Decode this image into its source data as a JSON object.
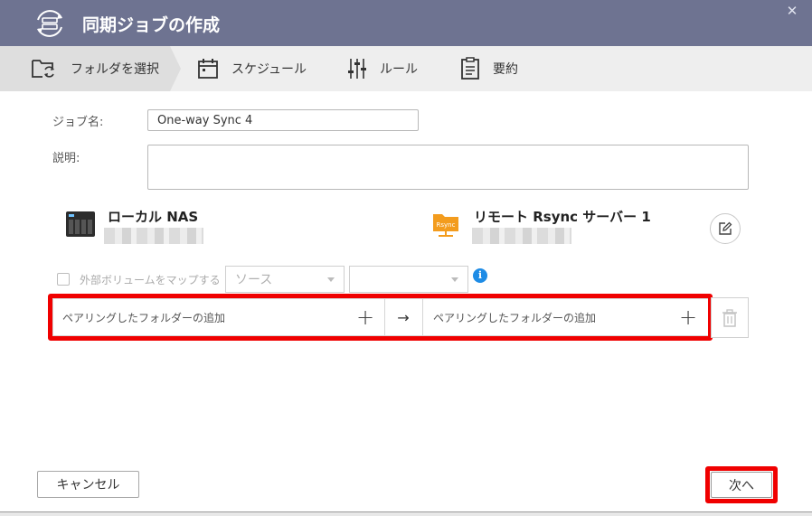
{
  "titlebar": {
    "title": "同期ジョブの作成",
    "close_symbol": "✕"
  },
  "steps": [
    {
      "label": "フォルダを選択",
      "icon": "folder-sync-icon",
      "active": true
    },
    {
      "label": "スケジュール",
      "icon": "calendar-icon",
      "active": false
    },
    {
      "label": "ルール",
      "icon": "sliders-icon",
      "active": false
    },
    {
      "label": "要約",
      "icon": "clipboard-icon",
      "active": false
    }
  ],
  "form": {
    "job_name_label": "ジョブ名:",
    "job_name_value": "One-way Sync 4",
    "description_label": "説明:",
    "description_value": ""
  },
  "local": {
    "name": "ローカル NAS",
    "icon": "nas-device-icon"
  },
  "remote": {
    "name": "リモート Rsync サーバー 1",
    "icon": "rsync-folder-icon",
    "badge": "Rsync"
  },
  "mapping": {
    "checkbox_label": "外部ボリュームをマップする",
    "source_select": "ソース",
    "second_select": "",
    "info_symbol": "i"
  },
  "pairing": {
    "left_label": "ペアリングしたフォルダーの追加",
    "right_label": "ペアリングしたフォルダーの追加",
    "plus": "+",
    "arrow": "→"
  },
  "buttons": {
    "cancel": "キャンセル",
    "next": "次へ"
  },
  "colors": {
    "titlebar": "#6e7391",
    "highlight": "#f00000",
    "info": "#1e8ce6",
    "rsync": "#f39c1e"
  }
}
